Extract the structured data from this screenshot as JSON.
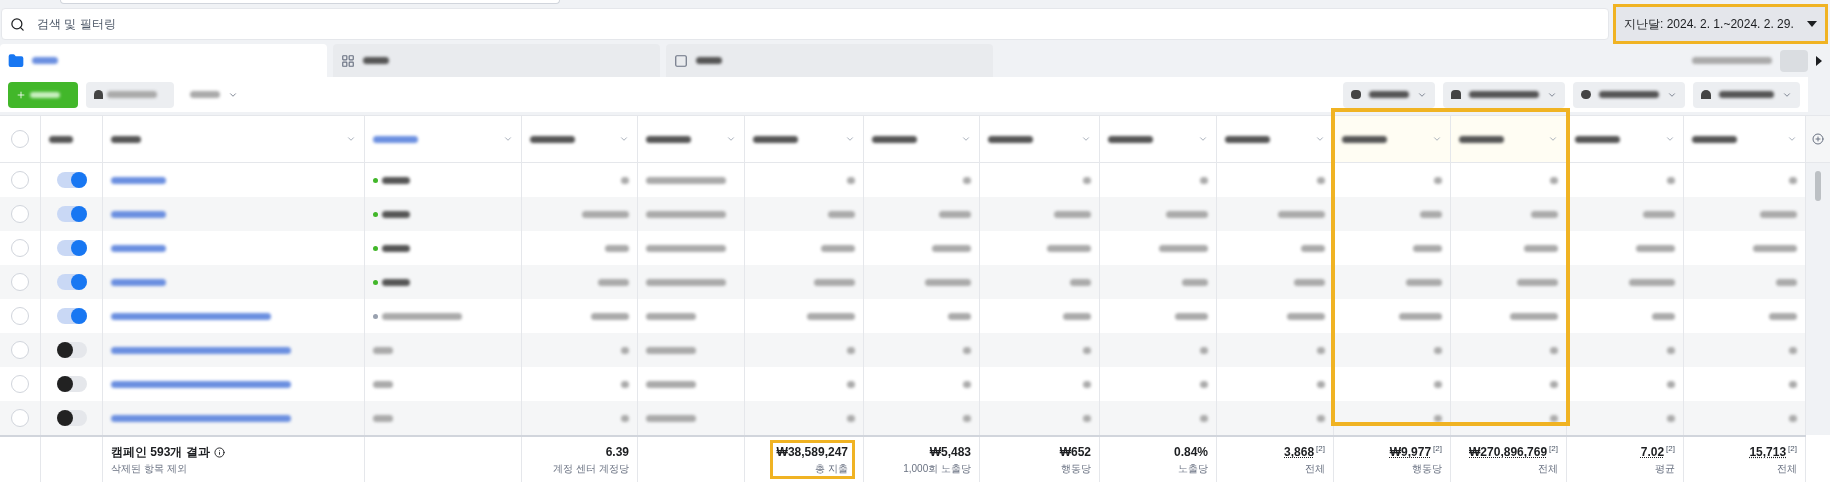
{
  "search": {
    "placeholder": "검색 및 필터링"
  },
  "date_range": {
    "label": "지난달: 2024. 2. 1.~2024. 2. 29.",
    "highlighted": true
  },
  "tabs": [
    {
      "kind": "folder",
      "selected": true
    },
    {
      "kind": "grid",
      "selected": false
    },
    {
      "kind": "square",
      "selected": false
    }
  ],
  "select_all": {
    "checked": false
  },
  "columns": [
    {
      "kind": "checkbox",
      "highlighted": false
    },
    {
      "kind": "toggle",
      "highlighted": false
    },
    {
      "kind": "name",
      "highlighted": false
    },
    {
      "kind": "status",
      "sorted": true,
      "highlighted": false
    },
    {
      "kind": "number",
      "highlighted": false
    },
    {
      "kind": "budget",
      "highlighted": false
    },
    {
      "kind": "number",
      "highlighted": false
    },
    {
      "kind": "number",
      "highlighted": false
    },
    {
      "kind": "number",
      "highlighted": false
    },
    {
      "kind": "number",
      "highlighted": false
    },
    {
      "kind": "number",
      "highlighted": false
    },
    {
      "kind": "number",
      "highlighted": true
    },
    {
      "kind": "number",
      "highlighted": true
    },
    {
      "kind": "number",
      "highlighted": false
    },
    {
      "kind": "number",
      "highlighted": false
    }
  ],
  "rows": [
    {
      "kind": "active",
      "checked": false,
      "on": true
    },
    {
      "kind": "active",
      "checked": false,
      "on": true
    },
    {
      "kind": "active",
      "checked": false,
      "on": true
    },
    {
      "kind": "active",
      "checked": false,
      "on": true
    },
    {
      "kind": "other",
      "checked": false,
      "on": true
    },
    {
      "kind": "plain",
      "checked": false,
      "on": false
    },
    {
      "kind": "plain",
      "checked": false,
      "on": false
    },
    {
      "kind": "plain",
      "checked": false,
      "on": false
    }
  ],
  "footer": [
    {
      "kind": "empty"
    },
    {
      "kind": "empty"
    },
    {
      "kind": "summary",
      "title": "캠페인 593개 결과",
      "subtitle": "삭제된 항목 제외"
    },
    {
      "kind": "empty"
    },
    {
      "kind": "value",
      "value": "6.39",
      "caption": "계정 센터 계정당",
      "highlighted": false
    },
    {
      "kind": "empty"
    },
    {
      "kind": "value",
      "value": "₩38,589,247",
      "caption": "총 지출",
      "highlighted": true
    },
    {
      "kind": "value",
      "value": "₩5,483",
      "caption": "1,000회 노출당",
      "highlighted": false
    },
    {
      "kind": "value",
      "value": "₩652",
      "caption": "행동당",
      "highlighted": false
    },
    {
      "kind": "value",
      "value": "0.84%",
      "caption": "노출당",
      "highlighted": false
    },
    {
      "kind": "value",
      "value": "3,868",
      "note": "[2]",
      "caption": "전체",
      "highlighted": false
    },
    {
      "kind": "value",
      "value": "₩9,977",
      "note": "[2]",
      "caption": "행동당",
      "highlighted": false
    },
    {
      "kind": "value",
      "value": "₩270,896,769",
      "note": "[2]",
      "caption": "전체",
      "highlighted": false
    },
    {
      "kind": "value",
      "value": "7.02",
      "note": "[2]",
      "caption": "평균",
      "highlighted": false
    },
    {
      "kind": "value",
      "value": "15,713",
      "note": "[2]",
      "caption": "전체",
      "highlighted": false
    }
  ]
}
